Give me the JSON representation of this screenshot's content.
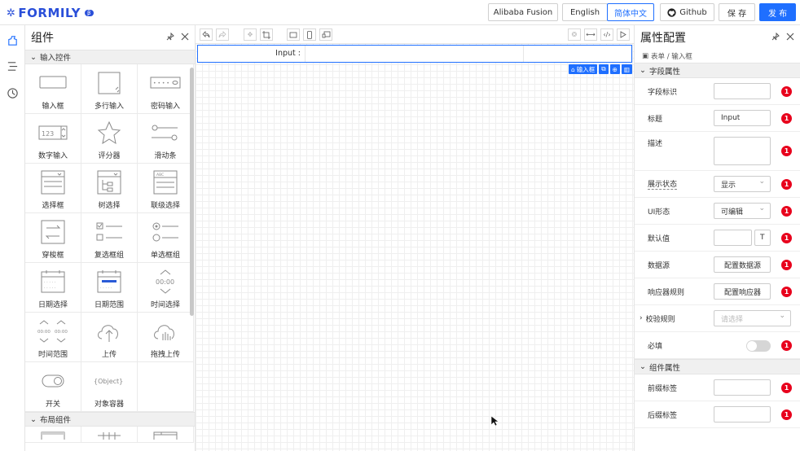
{
  "logo": {
    "text": "FORMILY",
    "version": "β"
  },
  "header": {
    "buttons": [
      "Alibaba Fusion",
      "English",
      "简体中文",
      "Github",
      "保 存",
      "发 布"
    ]
  },
  "components": {
    "title": "组件",
    "group1": "输入控件",
    "items": [
      {
        "label": "输入框",
        "icon": "input-icon"
      },
      {
        "label": "多行输入",
        "icon": "textarea-icon"
      },
      {
        "label": "密码输入",
        "icon": "password-icon"
      },
      {
        "label": "数字输入",
        "icon": "number-icon",
        "digits": "123"
      },
      {
        "label": "评分器",
        "icon": "rate-icon"
      },
      {
        "label": "滑动条",
        "icon": "slider-icon"
      },
      {
        "label": "选择框",
        "icon": "select-icon"
      },
      {
        "label": "树选择",
        "icon": "tree-select-icon"
      },
      {
        "label": "联级选择",
        "icon": "cascader-icon"
      },
      {
        "label": "穿梭框",
        "icon": "transfer-icon"
      },
      {
        "label": "复选框组",
        "icon": "checkbox-icon"
      },
      {
        "label": "单选框组",
        "icon": "radio-icon"
      },
      {
        "label": "日期选择",
        "icon": "date-icon"
      },
      {
        "label": "日期范围",
        "icon": "date-range-icon"
      },
      {
        "label": "时间选择",
        "icon": "time-icon",
        "time": "00:00"
      },
      {
        "label": "时间范围",
        "icon": "time-range-icon",
        "time": "00:00"
      },
      {
        "label": "上传",
        "icon": "upload-icon"
      },
      {
        "label": "拖拽上传",
        "icon": "drag-upload-icon"
      },
      {
        "label": "开关",
        "icon": "switch-icon"
      },
      {
        "label": "对象容器",
        "icon": "object-icon",
        "text": "{Object}"
      }
    ],
    "group2": "布局组件"
  },
  "canvas": {
    "formLabel": "Input :",
    "selectionTag": "输入框"
  },
  "properties": {
    "title": "属性配置",
    "breadcrumb": "表单 / 输入框",
    "section1": "字段属性",
    "rows": [
      {
        "label": "字段标识",
        "value": ""
      },
      {
        "label": "标题",
        "value": "Input"
      },
      {
        "label": "描述",
        "value": ""
      },
      {
        "label": "展示状态",
        "value": "显示"
      },
      {
        "label": "UI形态",
        "value": "可编辑"
      },
      {
        "label": "默认值",
        "value": "",
        "suffix": "T"
      },
      {
        "label": "数据源",
        "value": "配置数据源"
      },
      {
        "label": "响应器规则",
        "value": "配置响应器"
      },
      {
        "label": "校验规则",
        "value": "请选择"
      },
      {
        "label": "必填",
        "value": ""
      }
    ],
    "section2": "组件属性",
    "rows2": [
      {
        "label": "前缀标签",
        "value": ""
      },
      {
        "label": "后缀标签",
        "value": ""
      }
    ],
    "badge": "1"
  },
  "colors": {
    "accent": "#1f6fff",
    "badge": "#e8001c"
  }
}
